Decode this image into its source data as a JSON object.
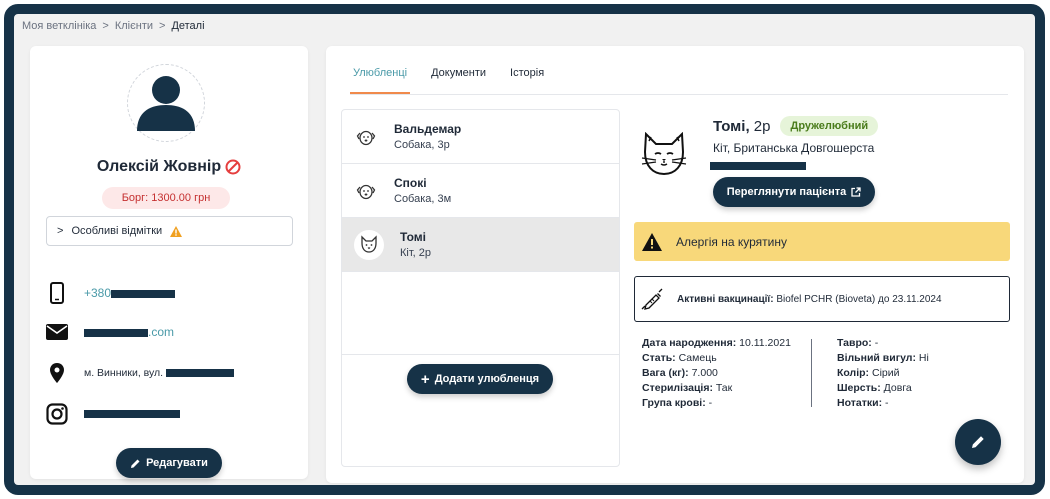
{
  "breadcrumb": [
    "Моя ветклініка",
    "Клієнти",
    "Деталі"
  ],
  "breadcrumb_sep": ">",
  "client": {
    "name": "Олексій Жовнір",
    "debt": "Борг: 1300.00 грн",
    "notes_label": "Особливі відмітки",
    "phone": "+380",
    "email_domain": ".com",
    "address": "м. Винники, вул.",
    "edit_label": "Редагувати"
  },
  "tabs": [
    "Улюбленці",
    "Документи",
    "Історія"
  ],
  "pets": [
    {
      "name": "Вальдемар",
      "sub": "Собака, 3р"
    },
    {
      "name": "Спокі",
      "sub": "Собака, 3м"
    },
    {
      "name": "Томі",
      "sub": "Кіт, 2р"
    }
  ],
  "add_pet_label": "Додати улюбленця",
  "detail": {
    "name": "Томі,",
    "age": "2р",
    "badge": "Дружелюбний",
    "breed": "Кіт, Британська Довгошерста",
    "view_label": "Переглянути пацієнта",
    "allergy": "Алергія на курятину",
    "vacc_label": "Активні вакцинації:",
    "vacc_value": "Biofel PCHR (Bioveta) до 23.11.2024",
    "info_left": [
      {
        "k": "Дата народження:",
        "v": "10.11.2021"
      },
      {
        "k": "Стать:",
        "v": "Самець"
      },
      {
        "k": "Вага (кг):",
        "v": "7.000"
      },
      {
        "k": "Стерилізація:",
        "v": "Так"
      },
      {
        "k": "Група крові:",
        "v": "-"
      }
    ],
    "info_right": [
      {
        "k": "Тавро:",
        "v": "-"
      },
      {
        "k": "Вільний вигул:",
        "v": "Ні"
      },
      {
        "k": "Колір:",
        "v": "Сірий"
      },
      {
        "k": "Шерсть:",
        "v": "Довга"
      },
      {
        "k": "Нотатки:",
        "v": "-"
      }
    ]
  },
  "colors": {
    "navy": "#163247",
    "accent": "#4a9aa8",
    "tab_underline": "#f08a4b",
    "alert_bg": "#f8d87a",
    "danger": "#e53e3e"
  }
}
